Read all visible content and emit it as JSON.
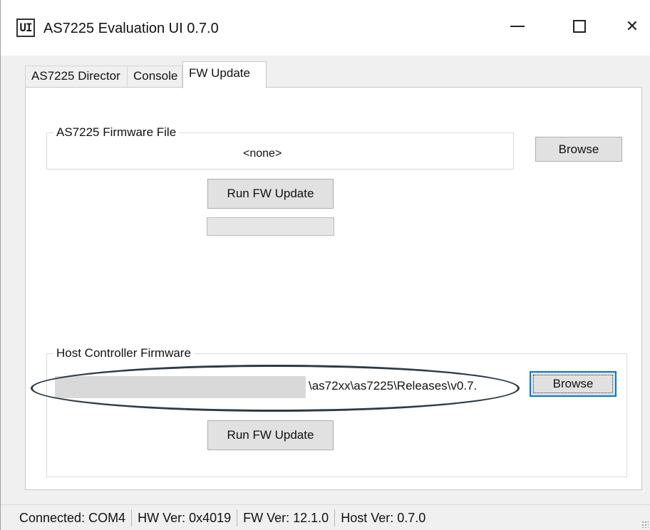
{
  "window": {
    "title": "AS7225 Evaluation UI 0.7.0",
    "icon": "app-logo-icon",
    "icon_glyph": "UI",
    "controls": [
      "minimize-icon",
      "maximize-icon",
      "close-icon"
    ],
    "close_glyph": "✕"
  },
  "tabs": [
    {
      "label": "AS7225 Director",
      "active": false
    },
    {
      "label": "Console",
      "active": false
    },
    {
      "label": "FW Update",
      "active": true
    }
  ],
  "fw_update": {
    "firmware_group": {
      "legend": "AS7225 Firmware File",
      "file_value": "<none>",
      "browse_label": "Browse",
      "run_label": "Run FW Update",
      "progress": 0
    },
    "host_group": {
      "legend": "Host Controller Firmware",
      "path_value": "\\as72xx\\as7225\\Releases\\v0.7.",
      "browse_label": "Browse",
      "run_label": "Run FW Update"
    }
  },
  "status_bar": {
    "connection": "Connected: COM4",
    "hw_version": "HW Ver: 0x4019",
    "fw_version": "FW Ver: 12.1.0",
    "host_version": "Host Ver: 0.7.0"
  },
  "colors": {
    "focus_border": "#0078d7",
    "annotation_ellipse": "#2e3a45"
  }
}
